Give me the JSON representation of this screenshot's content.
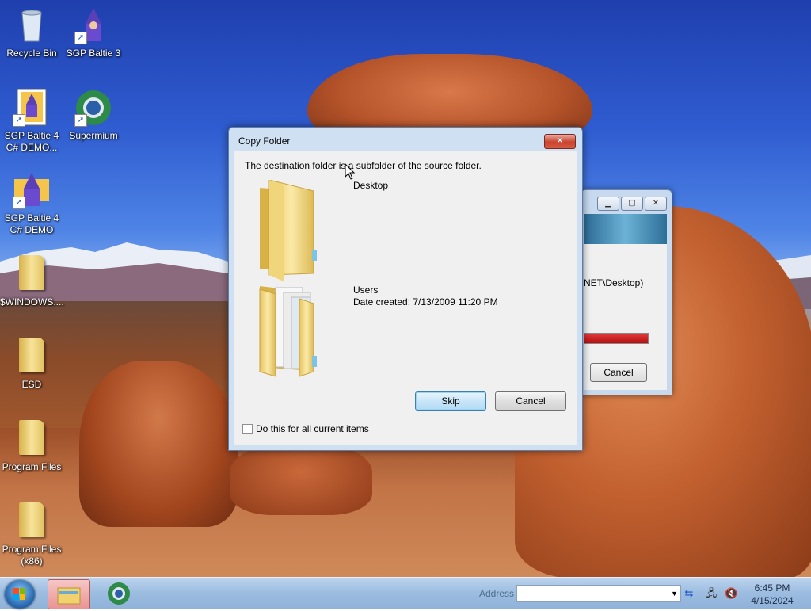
{
  "desktop": {
    "icons": [
      {
        "label": "Recycle Bin"
      },
      {
        "label": "SGP Baltie 3"
      },
      {
        "label": "SGP Baltie 4 C# DEMO..."
      },
      {
        "label": "Supermium"
      },
      {
        "label": "SGP Baltie 4 C# DEMO"
      },
      {
        "label": "$WINDOWS...."
      },
      {
        "label": "ESD"
      },
      {
        "label": "Program Files"
      },
      {
        "label": "Program Files (x86)"
      }
    ]
  },
  "background_window": {
    "path_fragment": "NET\\Desktop)",
    "progress_fraction": 1.0,
    "cancel_label": "Cancel",
    "progress_color": "#c8102e"
  },
  "dialog": {
    "title": "Copy Folder",
    "close_glyph": "✕",
    "message": "The destination folder is a subfolder of the source folder.",
    "destination": {
      "name": "Desktop"
    },
    "source": {
      "name": "Users",
      "date_created": "Date created: 7/13/2009 11:20 PM"
    },
    "skip_label": "Skip",
    "cancel_label": "Cancel",
    "checkbox_label": "Do this for all current items",
    "checkbox_checked": false
  },
  "taskbar": {
    "address_label": "Address",
    "address_value": "",
    "time": "6:45 PM",
    "date": "4/15/2024"
  }
}
